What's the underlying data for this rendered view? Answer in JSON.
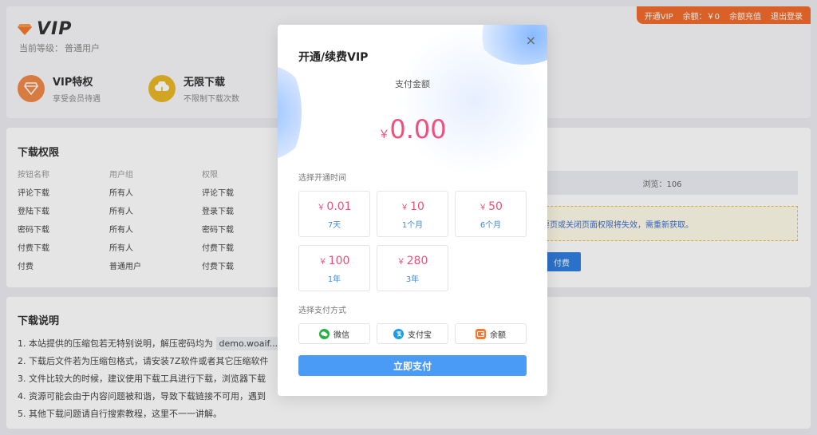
{
  "header": {
    "logo_text": "VIP",
    "level_label": "当前等级：",
    "level_value": "普通用户"
  },
  "topbar": {
    "open_vip": "开通VIP",
    "balance": "余额：￥0",
    "recharge": "余额充值",
    "logout": "退出登录"
  },
  "features": [
    {
      "title": "VIP特权",
      "desc": "享受会员待遇",
      "icon": "diamond-icon",
      "color": "#f08a48"
    },
    {
      "title": "无限下载",
      "desc": "不限制下载次数",
      "icon": "cloud-download-icon",
      "color": "#e9b828"
    }
  ],
  "permissions": {
    "title": "下载权限",
    "headers": [
      "按钮名称",
      "用户组",
      "权限"
    ],
    "rows": [
      [
        "评论下载",
        "所有人",
        "评论下载"
      ],
      [
        "登陆下载",
        "所有人",
        "登录下载"
      ],
      [
        "密码下载",
        "所有人",
        "密码下载"
      ],
      [
        "付费下载",
        "所有人",
        "付费下载"
      ],
      [
        "付费",
        "普通用户",
        "付费下载"
      ]
    ]
  },
  "side": {
    "views": "浏览：106",
    "warning": "要页或关闭页面权限将失效，需重新获取。",
    "pay_button": "付费"
  },
  "notes": {
    "title": "下载说明",
    "line1_prefix": "1. 本站提供的压缩包若无特别说明，解压密码均为",
    "line1_code": "demo.woaif...",
    "line2": "2. 下载后文件若为压缩包格式，请安装7Z软件或者其它压缩软件",
    "line3": "3. 文件比较大的时候，建议使用下载工具进行下载，浏览器下载",
    "line4": "4. 资源可能会由于内容问题被和谐，导致下载链接不可用，遇到",
    "line5": "5. 其他下载问题请自行搜索教程，这里不一一讲解。"
  },
  "modal": {
    "title": "开通/续费VIP",
    "close": "×",
    "amount_label": "支付金额",
    "currency": "￥",
    "amount": "0.00",
    "period_label": "选择开通时间",
    "plans": [
      {
        "price": "0.01",
        "duration": "7天"
      },
      {
        "price": "10",
        "duration": "1个月"
      },
      {
        "price": "50",
        "duration": "6个月"
      },
      {
        "price": "100",
        "duration": "1年"
      },
      {
        "price": "280",
        "duration": "3年"
      }
    ],
    "method_label": "选择支付方式",
    "methods": [
      {
        "label": "微信",
        "icon": "wechat-icon",
        "color": "#2aae44"
      },
      {
        "label": "支付宝",
        "icon": "alipay-icon",
        "color": "#1c9bea"
      },
      {
        "label": "余额",
        "icon": "wallet-icon",
        "color": "#f07a36"
      }
    ],
    "submit": "立即支付"
  }
}
